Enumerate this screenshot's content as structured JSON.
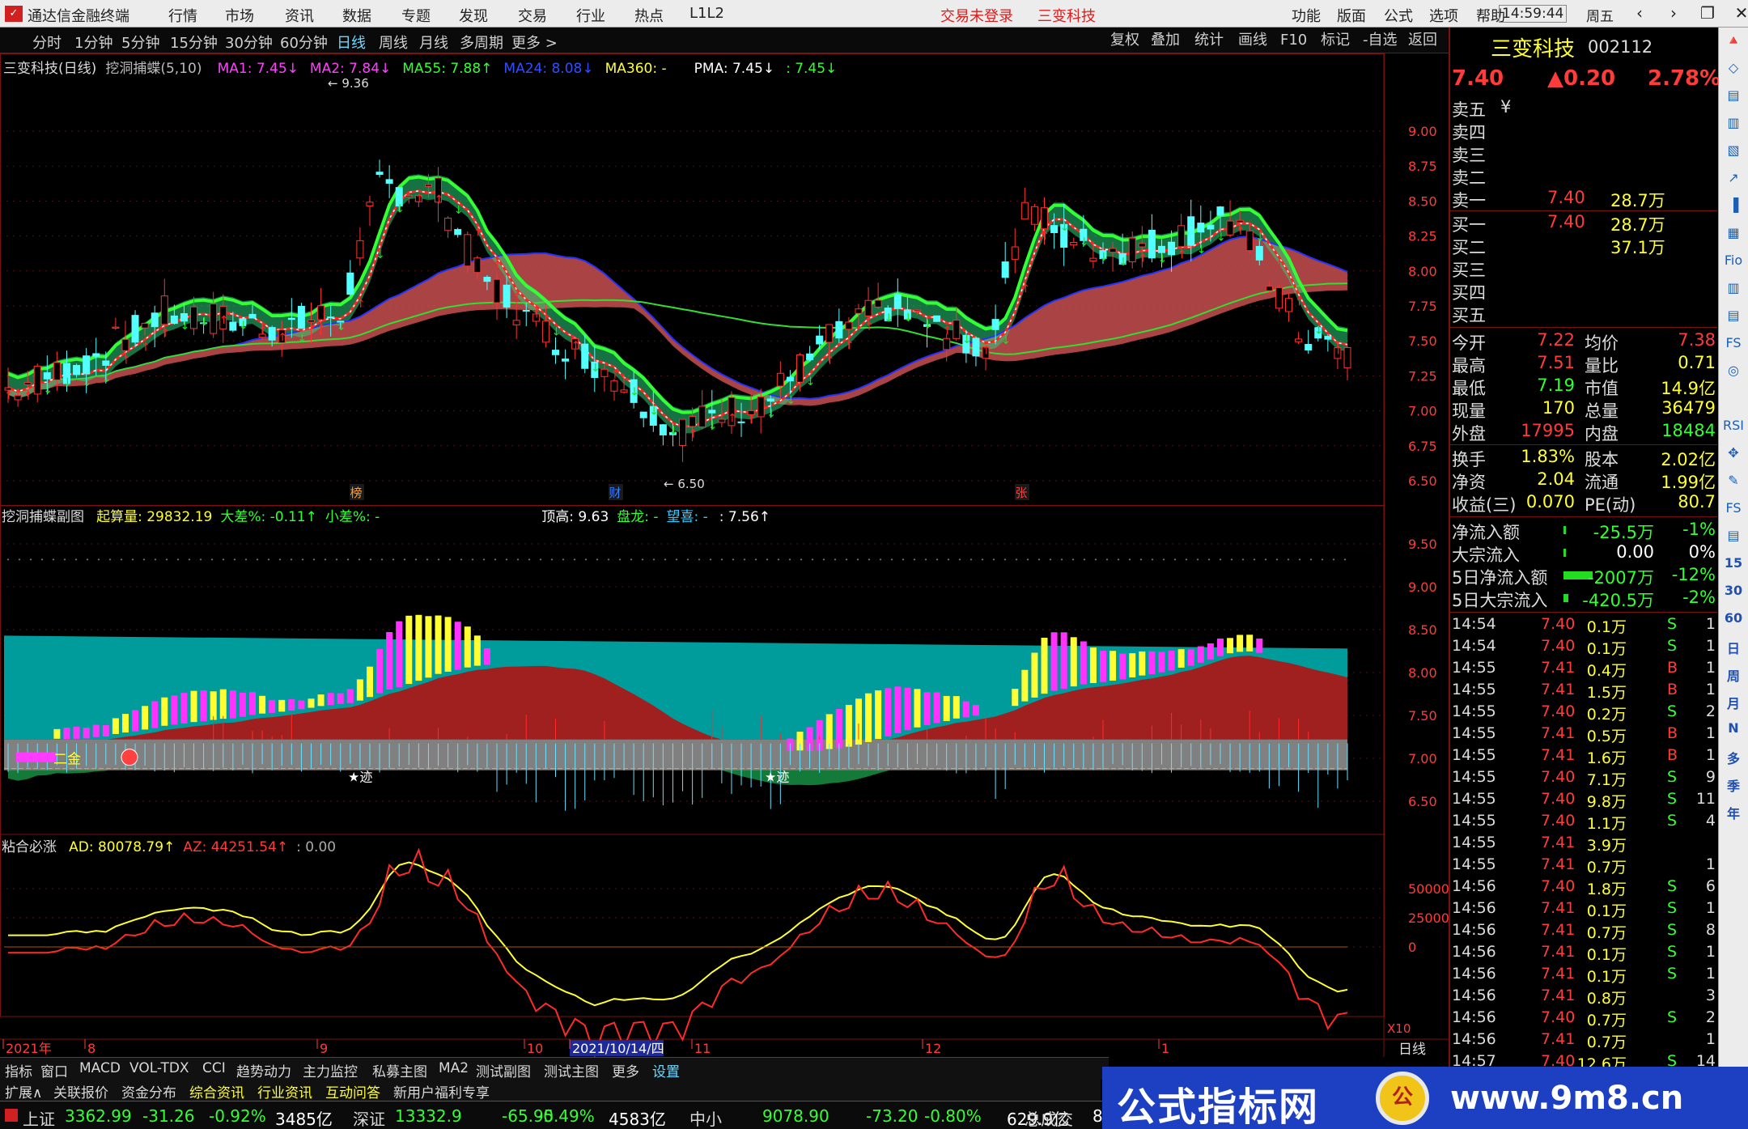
{
  "app": {
    "title": "通达信金融终端",
    "menus": [
      "行情",
      "市场",
      "资讯",
      "数据",
      "专题",
      "发现",
      "交易",
      "行业",
      "热点",
      "L1L2"
    ],
    "status1": "交易未登录",
    "status2": "三变科技",
    "right_menus": [
      "功能",
      "版面",
      "公式",
      "选项",
      "帮助"
    ],
    "clock": "14:59:44",
    "weekday": "周五",
    "win_buttons": [
      "‹",
      "›",
      "❐",
      "✕"
    ]
  },
  "periods": [
    "分时",
    "1分钟",
    "5分钟",
    "15分钟",
    "30分钟",
    "60分钟",
    "日线",
    "周线",
    "月线",
    "多周期",
    "更多 >"
  ],
  "active_period": "日线",
  "toolbar": [
    "复权",
    "叠加",
    "统计",
    "画线",
    "F10",
    "标记",
    "-自选",
    "返回"
  ],
  "main_chart": {
    "title": "三变科技(日线)",
    "indicator": "挖洞捕蝶(5,10)",
    "legend": [
      {
        "t": "MA1: 7.45↓",
        "c": "#ff40ff"
      },
      {
        "t": "MA2: 7.84↓",
        "c": "#ff40ff"
      },
      {
        "t": "MA55: 7.88↑",
        "c": "#33ff33"
      },
      {
        "t": "MA24: 8.08↓",
        "c": "#2f4fff"
      },
      {
        "t": "MA360: -",
        "c": "#ffff33"
      },
      {
        "t": "PMA: 7.45↓",
        "c": "#ffffff"
      },
      {
        "t": ": 7.45↓",
        "c": "#33ff33"
      }
    ],
    "hi_label": "← 9.36",
    "lo_label": "← 6.50",
    "yaxis": [
      "9.00",
      "8.75",
      "8.50",
      "8.25",
      "8.00",
      "7.75",
      "7.50",
      "7.25",
      "7.00",
      "6.75",
      "6.50"
    ],
    "markers": [
      {
        "t": "榜",
        "c": "#ff9e2c"
      },
      {
        "t": "财",
        "c": "#3b7bff"
      },
      {
        "t": "张",
        "c": "#ff3b3b"
      }
    ]
  },
  "sub1": {
    "title": "挖洞捕蝶副图",
    "items": [
      {
        "t": "起算量: 29832.19",
        "c": "#ffff33"
      },
      {
        "t": "大差%: -0.11↑",
        "c": "#33ff33"
      },
      {
        "t": "小差%: -",
        "c": "#33ff33"
      },
      {
        "t": "顶高: 9.63",
        "c": "#ffffff"
      },
      {
        "t": "盘龙: -",
        "c": "#33ff33"
      },
      {
        "t": "望喜: -",
        "c": "#33ccff"
      },
      {
        "t": ": 7.56↑",
        "c": "#ffffff"
      }
    ],
    "yaxis": [
      "9.50",
      "9.00",
      "8.50",
      "8.00",
      "7.50",
      "7.00",
      "6.50"
    ],
    "tags": [
      "二金",
      "★迹",
      "★迹"
    ]
  },
  "sub2": {
    "title": "粘合必涨",
    "items": [
      {
        "t": "AD: 80078.79↑",
        "c": "#ffff33"
      },
      {
        "t": "AZ: 44251.54↑",
        "c": "#ff3b3b"
      },
      {
        "t": ": 0.00",
        "c": "#aaaaaa"
      }
    ],
    "yaxis": [
      "50000",
      "25000",
      "0"
    ]
  },
  "xaxis": {
    "labels": [
      "2021年",
      "8",
      "9",
      "10",
      "2021/10/14/四",
      "11",
      "12",
      "1"
    ],
    "right_label": "日线",
    "zoom": "X10"
  },
  "quote": {
    "name": "三变科技",
    "code": "002112",
    "price": "7.40",
    "change": "▲0.20",
    "pct": "2.78%",
    "asks": [
      {
        "l": "卖五",
        "p": "",
        "v": "",
        "cur": "¥"
      },
      {
        "l": "卖四",
        "p": "",
        "v": ""
      },
      {
        "l": "卖三",
        "p": "",
        "v": ""
      },
      {
        "l": "卖二",
        "p": "",
        "v": ""
      },
      {
        "l": "卖一",
        "p": "7.40",
        "v": "28.7万"
      }
    ],
    "bids": [
      {
        "l": "买一",
        "p": "7.40",
        "v": "28.7万"
      },
      {
        "l": "买二",
        "p": "",
        "v": "37.1万"
      },
      {
        "l": "买三",
        "p": "",
        "v": ""
      },
      {
        "l": "买四",
        "p": "",
        "v": ""
      },
      {
        "l": "买五",
        "p": "",
        "v": ""
      }
    ],
    "stats": [
      {
        "a": "今开",
        "av": "7.22",
        "ac": "#ff3b3b",
        "b": "均价",
        "bv": "7.38",
        "bc": "#ff3b3b"
      },
      {
        "a": "最高",
        "av": "7.51",
        "ac": "#ff3b3b",
        "b": "量比",
        "bv": "0.71",
        "bc": "#ffff33"
      },
      {
        "a": "最低",
        "av": "7.19",
        "ac": "#33ff33",
        "b": "市值",
        "bv": "14.9亿",
        "bc": "#ffff33"
      },
      {
        "a": "现量",
        "av": "170",
        "ac": "#ffff33",
        "b": "总量",
        "bv": "36479",
        "bc": "#ffff33"
      },
      {
        "a": "外盘",
        "av": "17995",
        "ac": "#ff3b3b",
        "b": "内盘",
        "bv": "18484",
        "bc": "#33ff33"
      },
      {
        "a": "换手",
        "av": "1.83%",
        "ac": "#ffff33",
        "b": "股本",
        "bv": "2.02亿",
        "bc": "#ffff33"
      },
      {
        "a": "净资",
        "av": "2.04",
        "ac": "#ffff33",
        "b": "流通",
        "bv": "1.99亿",
        "bc": "#ffff33"
      },
      {
        "a": "收益(三)",
        "av": "0.070",
        "ac": "#ffff33",
        "b": "PE(动)",
        "bv": "80.7",
        "bc": "#ffff33"
      }
    ],
    "flows": [
      {
        "l": "净流入额",
        "v": "-25.5万",
        "p": "-1%",
        "c": "#33ff33",
        "bar": 0.01
      },
      {
        "l": "大宗流入",
        "v": "0.00",
        "p": "0%",
        "c": "#ffffff",
        "bar": 0.01
      },
      {
        "l": "5日净流入额",
        "v": "-2007万",
        "p": "-12%",
        "c": "#33ff33",
        "bar": 0.12
      },
      {
        "l": "5日大宗流入",
        "v": "-420.5万",
        "p": "-2%",
        "c": "#33ff33",
        "bar": 0.02
      }
    ],
    "ticks": [
      [
        "14:54",
        "7.40",
        "0.1万",
        "S",
        "1"
      ],
      [
        "14:54",
        "7.40",
        "0.1万",
        "S",
        "1"
      ],
      [
        "14:55",
        "7.41",
        "0.4万",
        "B",
        "1"
      ],
      [
        "14:55",
        "7.41",
        "1.5万",
        "B",
        "1"
      ],
      [
        "14:55",
        "7.40",
        "0.2万",
        "S",
        "2"
      ],
      [
        "14:55",
        "7.41",
        "0.5万",
        "B",
        "1"
      ],
      [
        "14:55",
        "7.41",
        "1.6万",
        "B",
        "1"
      ],
      [
        "14:55",
        "7.40",
        "7.1万",
        "S",
        "9"
      ],
      [
        "14:55",
        "7.40",
        "9.8万",
        "S",
        "11"
      ],
      [
        "14:55",
        "7.40",
        "1.1万",
        "S",
        "4"
      ],
      [
        "14:55",
        "7.41",
        "3.9万",
        "",
        ""
      ],
      [
        "14:55",
        "7.41",
        "0.7万",
        "",
        "1"
      ],
      [
        "14:56",
        "7.40",
        "1.8万",
        "S",
        "6"
      ],
      [
        "14:56",
        "7.41",
        "0.1万",
        "S",
        "1"
      ],
      [
        "14:56",
        "7.41",
        "0.7万",
        "S",
        "8"
      ],
      [
        "14:56",
        "7.41",
        "0.1万",
        "S",
        "1"
      ],
      [
        "14:56",
        "7.41",
        "0.1万",
        "S",
        "1"
      ],
      [
        "14:56",
        "7.41",
        "0.8万",
        "",
        "3"
      ],
      [
        "14:56",
        "7.40",
        "0.7万",
        "S",
        "2"
      ],
      [
        "14:56",
        "7.41",
        "0.7万",
        "",
        "1"
      ],
      [
        "14:57",
        "7.40",
        "12.6万",
        "S",
        "14"
      ]
    ]
  },
  "sidetools": [
    "🔺",
    "◇",
    "▤",
    "▥",
    "▧",
    "↗",
    "▐",
    "▦",
    "Fio",
    "▥",
    "▤",
    "FS",
    "◎",
    "",
    "RSI",
    "✥",
    "✎",
    "FS",
    "▤",
    "15",
    "30",
    "60",
    "日",
    "周",
    "月",
    "N",
    "多",
    "季",
    "年"
  ],
  "bottom_tabs": [
    "指标",
    "窗口",
    "MACD",
    "VOL-TDX",
    "CCI",
    "趋势动力",
    "主力监控",
    "私募主图",
    "MA2",
    "测试副图",
    "测试主图",
    "更多",
    "设置"
  ],
  "bottom_tabs2": [
    {
      "t": "扩展∧",
      "c": "#d8d8d8"
    },
    {
      "t": "关联报价",
      "c": "#d8d8d8"
    },
    {
      "t": "资金分布",
      "c": "#d8d8d8"
    },
    {
      "t": "综合资讯",
      "c": "#ffff33"
    },
    {
      "t": "行业资讯",
      "c": "#ffff33"
    },
    {
      "t": "互动问答",
      "c": "#ffff33"
    },
    {
      "t": "新用户福利专享",
      "c": "#d8d8d8"
    }
  ],
  "index_bar": [
    {
      "t": "上证",
      "c": "#d8d8d8"
    },
    {
      "t": "3362.99",
      "c": "#33ff33"
    },
    {
      "t": "-31.26",
      "c": "#33ff33"
    },
    {
      "t": "-0.92%",
      "c": "#33ff33"
    },
    {
      "t": "3485亿",
      "c": "#ffffff"
    },
    {
      "t": "深证",
      "c": "#d8d8d8"
    },
    {
      "t": "13332.9",
      "c": "#33ff33"
    },
    {
      "t": "-65.95",
      "c": "#33ff33"
    },
    {
      "t": "-0.49%",
      "c": "#33ff33"
    },
    {
      "t": "4583亿",
      "c": "#ffffff"
    },
    {
      "t": "中小",
      "c": "#d8d8d8"
    },
    {
      "t": "9078.90",
      "c": "#33ff33"
    },
    {
      "t": "-73.20",
      "c": "#33ff33"
    },
    {
      "t": "-0.80%",
      "c": "#33ff33"
    },
    {
      "t": "629.9亿",
      "c": "#ffffff"
    },
    {
      "t": "总成交",
      "c": "#d8d8d8"
    },
    {
      "t": "8",
      "c": "#ffffff"
    }
  ],
  "ad": {
    "text": "公式指标网",
    "coin": "公",
    "url": "www.9m8.cn"
  }
}
